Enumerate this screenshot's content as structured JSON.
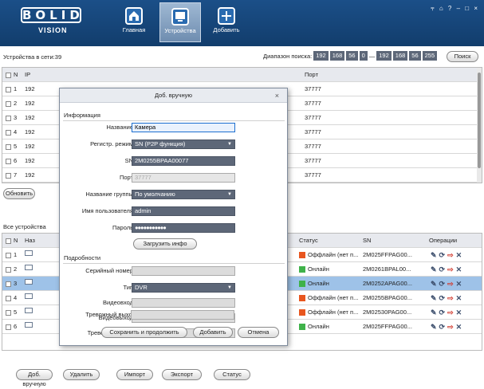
{
  "app": {
    "logo_main": "BOLID",
    "logo_sub": "VISION",
    "window_controls": "⫧ ⌂ ? – □ ×"
  },
  "nav": [
    {
      "label": "Главная",
      "icon": "home-icon"
    },
    {
      "label": "Устройства",
      "icon": "devices-icon"
    },
    {
      "label": "Добавить",
      "icon": "add-icon"
    }
  ],
  "network": {
    "title": "Устройства в сети:39",
    "range_label": "Диапазон поиска:",
    "ip_from": [
      "192",
      "168",
      "56",
      "0"
    ],
    "dash": "—",
    "ip_to": [
      "192",
      "168",
      "56",
      "255"
    ],
    "search_label": "Поиск",
    "columns": {
      "n": "N",
      "ip": "IP",
      "port": "Порт"
    },
    "rows": [
      {
        "n": "1",
        "ip": "192",
        "port": "37777"
      },
      {
        "n": "2",
        "ip": "192",
        "port": "37777"
      },
      {
        "n": "3",
        "ip": "192",
        "port": "37777"
      },
      {
        "n": "4",
        "ip": "192",
        "port": "37777"
      },
      {
        "n": "5",
        "ip": "192",
        "port": "37777"
      },
      {
        "n": "6",
        "ip": "192",
        "port": "37777"
      },
      {
        "n": "7",
        "ip": "192",
        "port": "37777"
      }
    ],
    "refresh_label": "Обновить"
  },
  "all": {
    "title": "Все устройства",
    "columns": {
      "n": "N",
      "name": "Наз",
      "status": "Статус",
      "sn": "SN",
      "ops": "Операции"
    },
    "rows": [
      {
        "n": "1",
        "status": "Оффлайн (нет п...",
        "status_color": "#e8561f",
        "sn": "2M025FFPAG00..."
      },
      {
        "n": "2",
        "status": "Онлайн",
        "status_color": "#3fb24a",
        "sn": "2M0261BPAL00..."
      },
      {
        "n": "3",
        "status": "Онлайн",
        "status_color": "#3fb24a",
        "sn": "2M0252APAG00..."
      },
      {
        "n": "4",
        "status": "Оффлайн (нет п...",
        "status_color": "#e8561f",
        "sn": "2M0255BPAG00..."
      },
      {
        "n": "5",
        "status": "Оффлайн (нет п...",
        "status_color": "#e8561f",
        "sn": "2M02530PAG00..."
      },
      {
        "n": "6",
        "status": "Онлайн",
        "status_color": "#3fb24a",
        "sn": "2M025FFPAG00..."
      }
    ],
    "ops_icons": [
      "edit-icon",
      "refresh-icon",
      "export-icon",
      "delete-icon"
    ]
  },
  "bottom_buttons": [
    "Доб. вручную",
    "Удалить",
    "Импорт",
    "Экспорт",
    "Статус"
  ],
  "dialog": {
    "title": "Доб. вручную",
    "close": "×",
    "info_section": "Информация",
    "name_label": "Название",
    "name_value": "Камера",
    "reg_label": "Регистр. режим",
    "reg_value": "SN (P2P функция)",
    "sn_label": "SN",
    "sn_value": "2M0255BPAA00077",
    "port_label": "Порт",
    "port_value": "37777",
    "group_label": "Название группы",
    "group_value": "По умолчанию",
    "user_label": "Имя пользователя",
    "user_value": "admin",
    "pass_label": "Пароль",
    "pass_value": "●●●●●●●●●●●",
    "load_info": "Загрузить инфо",
    "details_section": "Подробности",
    "serial_label": "Серийный номер",
    "type_label": "Тип",
    "type_value": "DVR",
    "vin_label": "Видеовход",
    "vout_label": "Видеовыход",
    "ain_label": "Тревожный вход",
    "aout_label": "Тревожный выход",
    "save_continue": "Сохранить и продолжить",
    "add": "Добавить",
    "cancel": "Отмена"
  }
}
